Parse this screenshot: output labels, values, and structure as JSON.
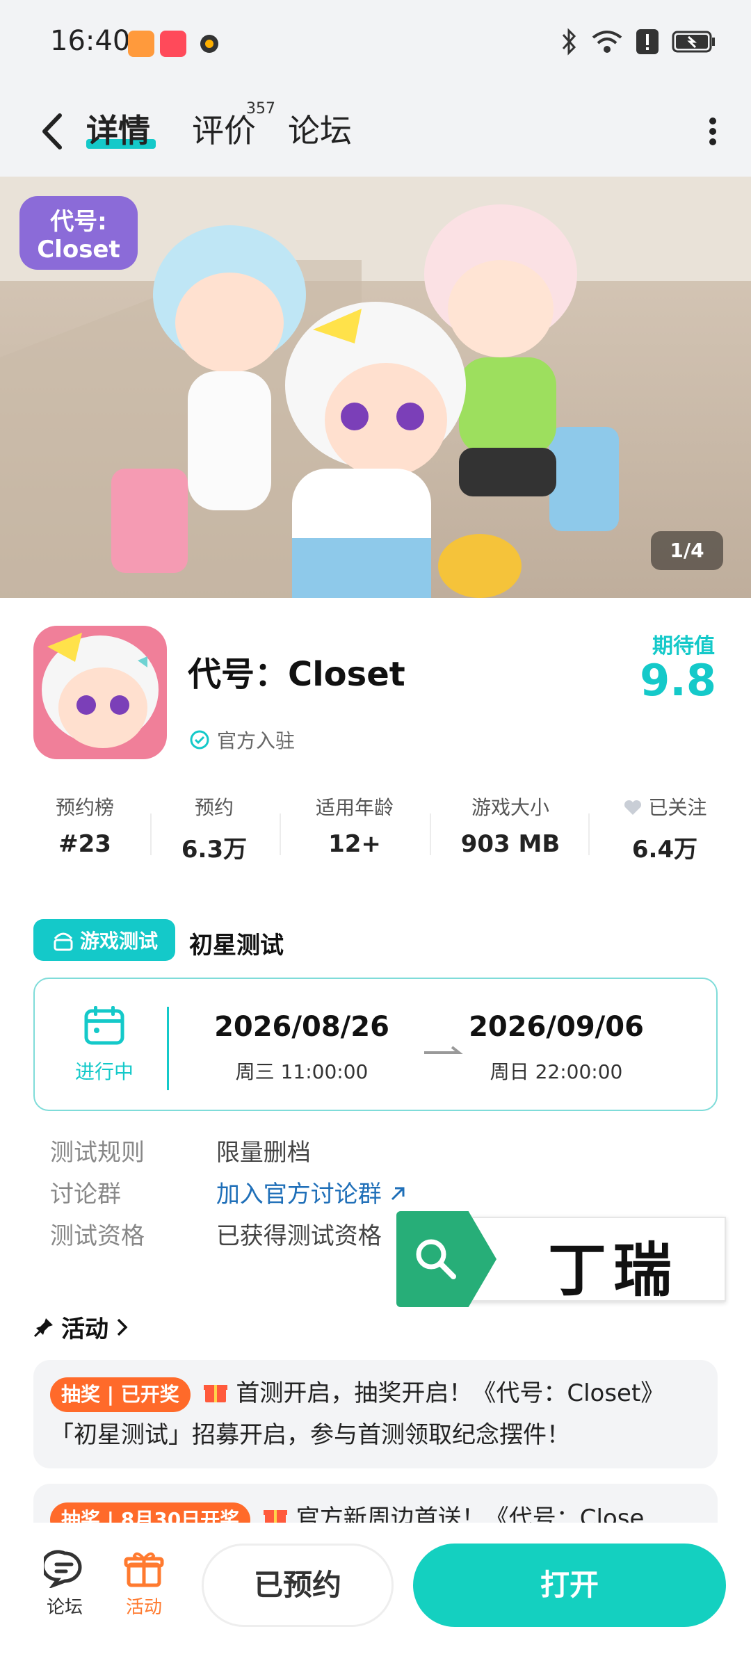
{
  "status_bar": {
    "time": "16:40"
  },
  "nav": {
    "tabs": [
      {
        "label": "详情",
        "active": true
      },
      {
        "label": "评价",
        "count": "357"
      },
      {
        "label": "论坛"
      }
    ]
  },
  "hero": {
    "logo_text": "代号:Closet",
    "page_indicator": "1/4"
  },
  "app": {
    "title": "代号：Closet",
    "official_label": "官方入驻",
    "score_label": "期待值",
    "score_value": "9.8"
  },
  "stats": [
    {
      "label": "预约榜",
      "value": "#23"
    },
    {
      "label": "预约",
      "value": "6.3万"
    },
    {
      "label": "适用年龄",
      "value": "12+"
    },
    {
      "label": "游戏大小",
      "value": "903 MB"
    },
    {
      "label": "已关注",
      "value": "6.4万"
    }
  ],
  "test": {
    "badge": "游戏测试",
    "name": "初星测试",
    "status": "进行中",
    "start_date": "2026/08/26",
    "start_time": "周三  11:00:00",
    "end_date": "2026/09/06",
    "end_time": "周日  22:00:00",
    "rules": [
      {
        "label": "测试规则",
        "value": "限量删档"
      },
      {
        "label": "讨论群",
        "value": "加入官方讨论群"
      },
      {
        "label": "测试资格",
        "value": "已获得测试资格"
      }
    ]
  },
  "search_overlay": {
    "text": "丁瑞"
  },
  "activities": {
    "title": "活动",
    "items": [
      {
        "tag": "抽奖 | 已开奖",
        "line1": "首测开启，抽奖开启！《代号：Closet》",
        "line2": "「初星测试」招募开启，参与首测领取纪念摆件！"
      },
      {
        "tag": "抽奖 | 8月30日开奖",
        "line1": "官方新周边首送！《代号：Close..."
      }
    ]
  },
  "bottom_bar": {
    "forum_label": "论坛",
    "activity_label": "活动",
    "reserved_button": "已预约",
    "open_button": "打开"
  },
  "colors": {
    "accent": "#14c9c9",
    "orange": "#ff6a2a",
    "link": "#1f6fb8"
  }
}
